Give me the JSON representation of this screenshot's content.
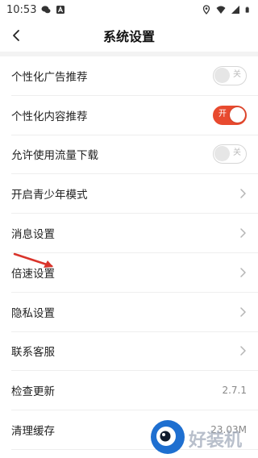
{
  "status_bar": {
    "time": "10:53",
    "left_icons": [
      "wechat-icon",
      "notification-a-icon"
    ],
    "right_icons": [
      "location-icon",
      "wifi-icon",
      "signal-icon",
      "battery-icon"
    ]
  },
  "nav": {
    "title": "系统设置",
    "back_icon": "chevron-left-icon"
  },
  "colors": {
    "accent": "#e84a2f",
    "toggle_off_border": "#d6d6d6",
    "divider": "#eeeeee"
  },
  "settings": [
    {
      "label": "个性化广告推荐",
      "type": "toggle",
      "state": "off",
      "toggle_text": "关"
    },
    {
      "label": "个性化内容推荐",
      "type": "toggle",
      "state": "on",
      "toggle_text": "开"
    },
    {
      "label": "允许使用流量下载",
      "type": "toggle",
      "state": "off",
      "toggle_text": "关"
    },
    {
      "label": "开启青少年模式",
      "type": "link"
    },
    {
      "label": "消息设置",
      "type": "link"
    },
    {
      "label": "倍速设置",
      "type": "link"
    },
    {
      "label": "隐私设置",
      "type": "link"
    },
    {
      "label": "联系客服",
      "type": "link"
    },
    {
      "label": "检查更新",
      "type": "value",
      "value": "2.7.1"
    },
    {
      "label": "清理缓存",
      "type": "value",
      "value": "23.03M"
    }
  ],
  "watermark": {
    "text": "好装机"
  }
}
